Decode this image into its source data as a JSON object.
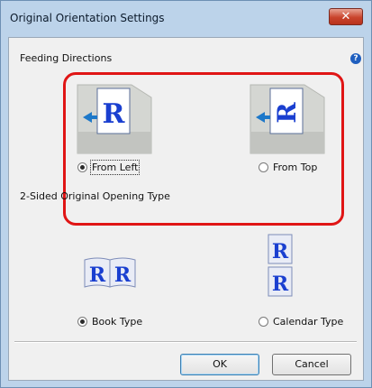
{
  "window": {
    "title": "Original Orientation Settings",
    "close_glyph": "✕"
  },
  "feeding": {
    "label": "Feeding Directions",
    "help_glyph": "?",
    "options": [
      {
        "label": "From Left",
        "selected": true
      },
      {
        "label": "From Top",
        "selected": false
      }
    ],
    "highlight_color": "#e01515"
  },
  "opening": {
    "label": "2-Sided Original Opening Type",
    "options": [
      {
        "label": "Book Type",
        "selected": true
      },
      {
        "label": "Calendar Type",
        "selected": false
      }
    ]
  },
  "glyph": "R",
  "buttons": {
    "ok": "OK",
    "cancel": "Cancel"
  },
  "colors": {
    "accent_blue": "#1a3fd0",
    "title_bar": "#bcd3ea"
  }
}
